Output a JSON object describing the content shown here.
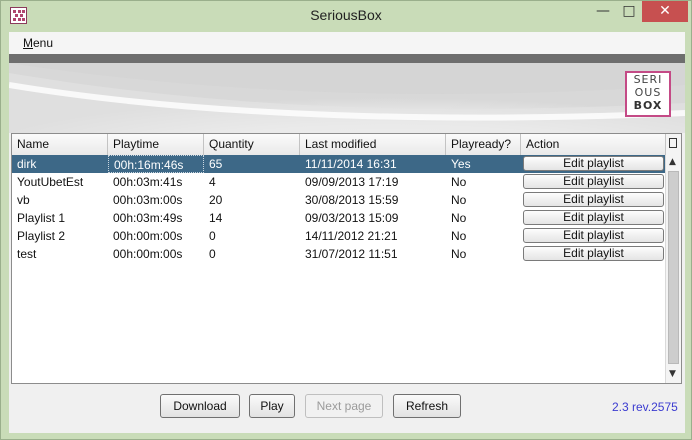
{
  "window": {
    "title": "SeriousBox",
    "controls": {
      "minimize": "—",
      "maximize": "□",
      "close": "✕"
    }
  },
  "menu": {
    "label_prefix": "M",
    "label_rest": "enu"
  },
  "logo": {
    "line1": "SERI",
    "line2": "OUS",
    "line3": "BOX",
    "border_color": "#c44a86"
  },
  "table": {
    "columns": [
      "Name",
      "Playtime",
      "Quantity",
      "Last modified",
      "Playready?",
      "Action"
    ],
    "rows": [
      {
        "name": "dirk",
        "playtime": "00h:16m:46s",
        "quantity": "65",
        "last_modified": "11/11/2014 16:31",
        "playready": "Yes",
        "action": "Edit playlist",
        "selected": true
      },
      {
        "name": "YoutUbetEst",
        "playtime": "00h:03m:41s",
        "quantity": "4",
        "last_modified": "09/09/2013 17:19",
        "playready": "No",
        "action": "Edit playlist",
        "selected": false
      },
      {
        "name": "vb",
        "playtime": "00h:03m:00s",
        "quantity": "20",
        "last_modified": "30/08/2013 15:59",
        "playready": "No",
        "action": "Edit playlist",
        "selected": false
      },
      {
        "name": "Playlist 1",
        "playtime": "00h:03m:49s",
        "quantity": "14",
        "last_modified": "09/03/2013 15:09",
        "playready": "No",
        "action": "Edit playlist",
        "selected": false
      },
      {
        "name": "Playlist 2",
        "playtime": "00h:00m:00s",
        "quantity": "0",
        "last_modified": "14/11/2012 21:21",
        "playready": "No",
        "action": "Edit playlist",
        "selected": false
      },
      {
        "name": "test",
        "playtime": "00h:00m:00s",
        "quantity": "0",
        "last_modified": "31/07/2012 11:51",
        "playready": "No",
        "action": "Edit playlist",
        "selected": false
      }
    ],
    "selected_row_color": "#3d6887"
  },
  "buttons": {
    "download": "Download",
    "play": "Play",
    "next_page": "Next page",
    "refresh": "Refresh"
  },
  "version": {
    "text": "2.3 rev.2575",
    "color": "#3b3bd0"
  },
  "colors": {
    "window_frame": "#c9dcb8",
    "close_button": "#c75050"
  }
}
